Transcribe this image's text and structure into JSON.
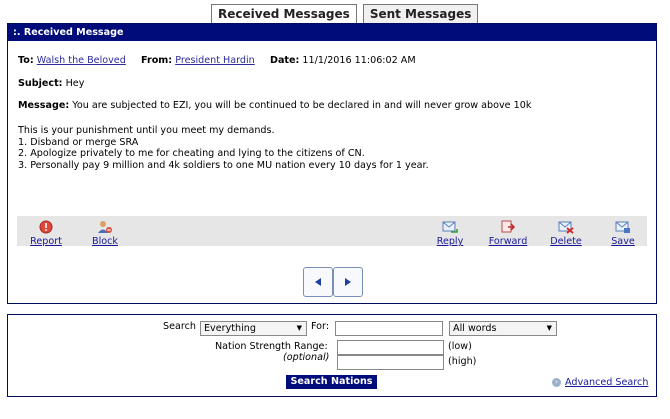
{
  "tabs": [
    {
      "label": "Received Messages",
      "active": true
    },
    {
      "label": "Sent Messages",
      "active": false
    }
  ],
  "message": {
    "header": ":. Received Message",
    "to_label": "To:",
    "to_value": "Walsh the Beloved",
    "from_label": "From:",
    "from_value": "President Hardin",
    "date_label": "Date:",
    "date_value": "11/1/2016 11:06:02 AM",
    "subject_label": "Subject:",
    "subject_value": "Hey",
    "message_label": "Message:",
    "message_first": "You are subjected to EZI, you will be continued to be declared in and will never grow above 10k",
    "body_lines": [
      "This is your punishment until you meet my demands.",
      "1. Disband or merge SRA",
      "2. Apologize privately to me for cheating and lying to the citizens of CN.",
      "3. Personally pay 9 million and 4k soldiers to one MU nation every 10 days for 1 year."
    ]
  },
  "actions": {
    "report": "Report",
    "block": "Block",
    "reply": "Reply",
    "forward": "Forward",
    "delete": "Delete",
    "save": "Save"
  },
  "pager": {
    "prev_icon": "arrow-left-icon",
    "next_icon": "arrow-right-icon"
  },
  "search": {
    "search_label": "Search",
    "scope_value": "Everything",
    "for_label": "For:",
    "for_value": "",
    "match_value": "All words",
    "range_label": "Nation Strength Range:",
    "optional_label": "(optional)",
    "low_label": "(low)",
    "high_label": "(high)",
    "low_value": "",
    "high_value": "",
    "button_label": "Search Nations",
    "advanced_label": "Advanced Search"
  },
  "colors": {
    "header_bg": "#000c7a",
    "link": "#1a1a9a"
  }
}
